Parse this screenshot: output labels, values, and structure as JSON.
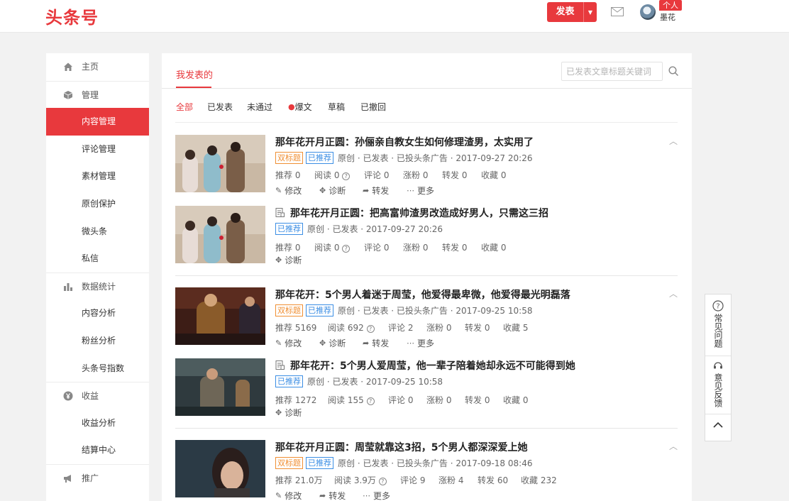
{
  "header": {
    "logo": "头条号",
    "publish_label": "发表",
    "user_tag": "个人",
    "username": "墨花"
  },
  "sidebar": {
    "items": [
      {
        "label": "主页",
        "group": true,
        "icon": "home-icon"
      },
      {
        "label": "管理",
        "group": true,
        "icon": "cube-icon"
      },
      {
        "label": "内容管理",
        "active": true
      },
      {
        "label": "评论管理"
      },
      {
        "label": "素材管理"
      },
      {
        "label": "原创保护"
      },
      {
        "label": "微头条"
      },
      {
        "label": "私信"
      },
      {
        "label": "数据统计",
        "group": true,
        "icon": "bar-chart-icon"
      },
      {
        "label": "内容分析"
      },
      {
        "label": "粉丝分析"
      },
      {
        "label": "头条号指数"
      },
      {
        "label": "收益",
        "group": true,
        "icon": "yen-icon"
      },
      {
        "label": "收益分析"
      },
      {
        "label": "结算中心"
      },
      {
        "label": "推广",
        "group": true,
        "icon": "megaphone-icon"
      }
    ]
  },
  "main": {
    "tab": "我发表的",
    "search_placeholder": "已发表文章标题关键词",
    "filters": [
      "全部",
      "已发表",
      "未通过",
      "爆文",
      "草稿",
      "已撤回"
    ]
  },
  "articles": [
    {
      "title": "那年花开月正圆：孙俪亲自教女生如何修理渣男，太实用了",
      "badges": [
        "双标题",
        "已推荐"
      ],
      "meta": "原创 · 已发表 · 已投头条广告 · 2017-09-27 20:26",
      "stats": [
        "推荐 0",
        "阅读 0",
        "评论 0",
        "涨粉 0",
        "转发 0",
        "收藏 0"
      ],
      "actions": [
        "修改",
        "诊断",
        "转发",
        "更多"
      ]
    },
    {
      "title": "那年花开月正圆：把高富帅渣男改造成好男人，只需这三招",
      "badges": [
        "已推荐"
      ],
      "meta": "原创 · 已发表 · 2017-09-27 20:26",
      "stats": [
        "推荐 0",
        "阅读 0",
        "评论 0",
        "涨粉 0",
        "转发 0",
        "收藏 0"
      ],
      "actions": [
        "诊断"
      ]
    },
    {
      "title": "那年花开：5个男人着迷于周莹，他爱得最卑微，他爱得最光明磊落",
      "badges": [
        "双标题",
        "已推荐"
      ],
      "meta": "原创 · 已发表 · 已投头条广告 · 2017-09-25 10:58",
      "stats": [
        "推荐 5169",
        "阅读 692",
        "评论 2",
        "涨粉 0",
        "转发 0",
        "收藏 5"
      ],
      "actions": [
        "修改",
        "诊断",
        "转发",
        "更多"
      ]
    },
    {
      "title": "那年花开：5个男人爱周莹，他一辈子陪着她却永远不可能得到她",
      "badges": [
        "已推荐"
      ],
      "meta": "原创 · 已发表 · 2017-09-25 10:58",
      "stats": [
        "推荐 1272",
        "阅读 155",
        "评论 0",
        "涨粉 0",
        "转发 0",
        "收藏 0"
      ],
      "actions": [
        "诊断"
      ]
    },
    {
      "title": "那年花开月正圆：周莹就靠这3招，5个男人都深深爱上她",
      "badges": [
        "双标题",
        "已推荐"
      ],
      "meta": "原创 · 已发表 · 已投头条广告 · 2017-09-18 08:46",
      "stats": [
        "推荐 21.0万",
        "阅读 3.9万",
        "评论 9",
        "涨粉 4",
        "转发 60",
        "收藏 232"
      ],
      "actions": [
        "修改",
        "转发",
        "更多"
      ]
    }
  ],
  "float_bar": {
    "faq": "常见问题",
    "feedback": "意见反馈"
  },
  "colors": {
    "brand": "#e8393d",
    "badge_orange": "#f08f33",
    "badge_blue": "#3b8ee4"
  }
}
